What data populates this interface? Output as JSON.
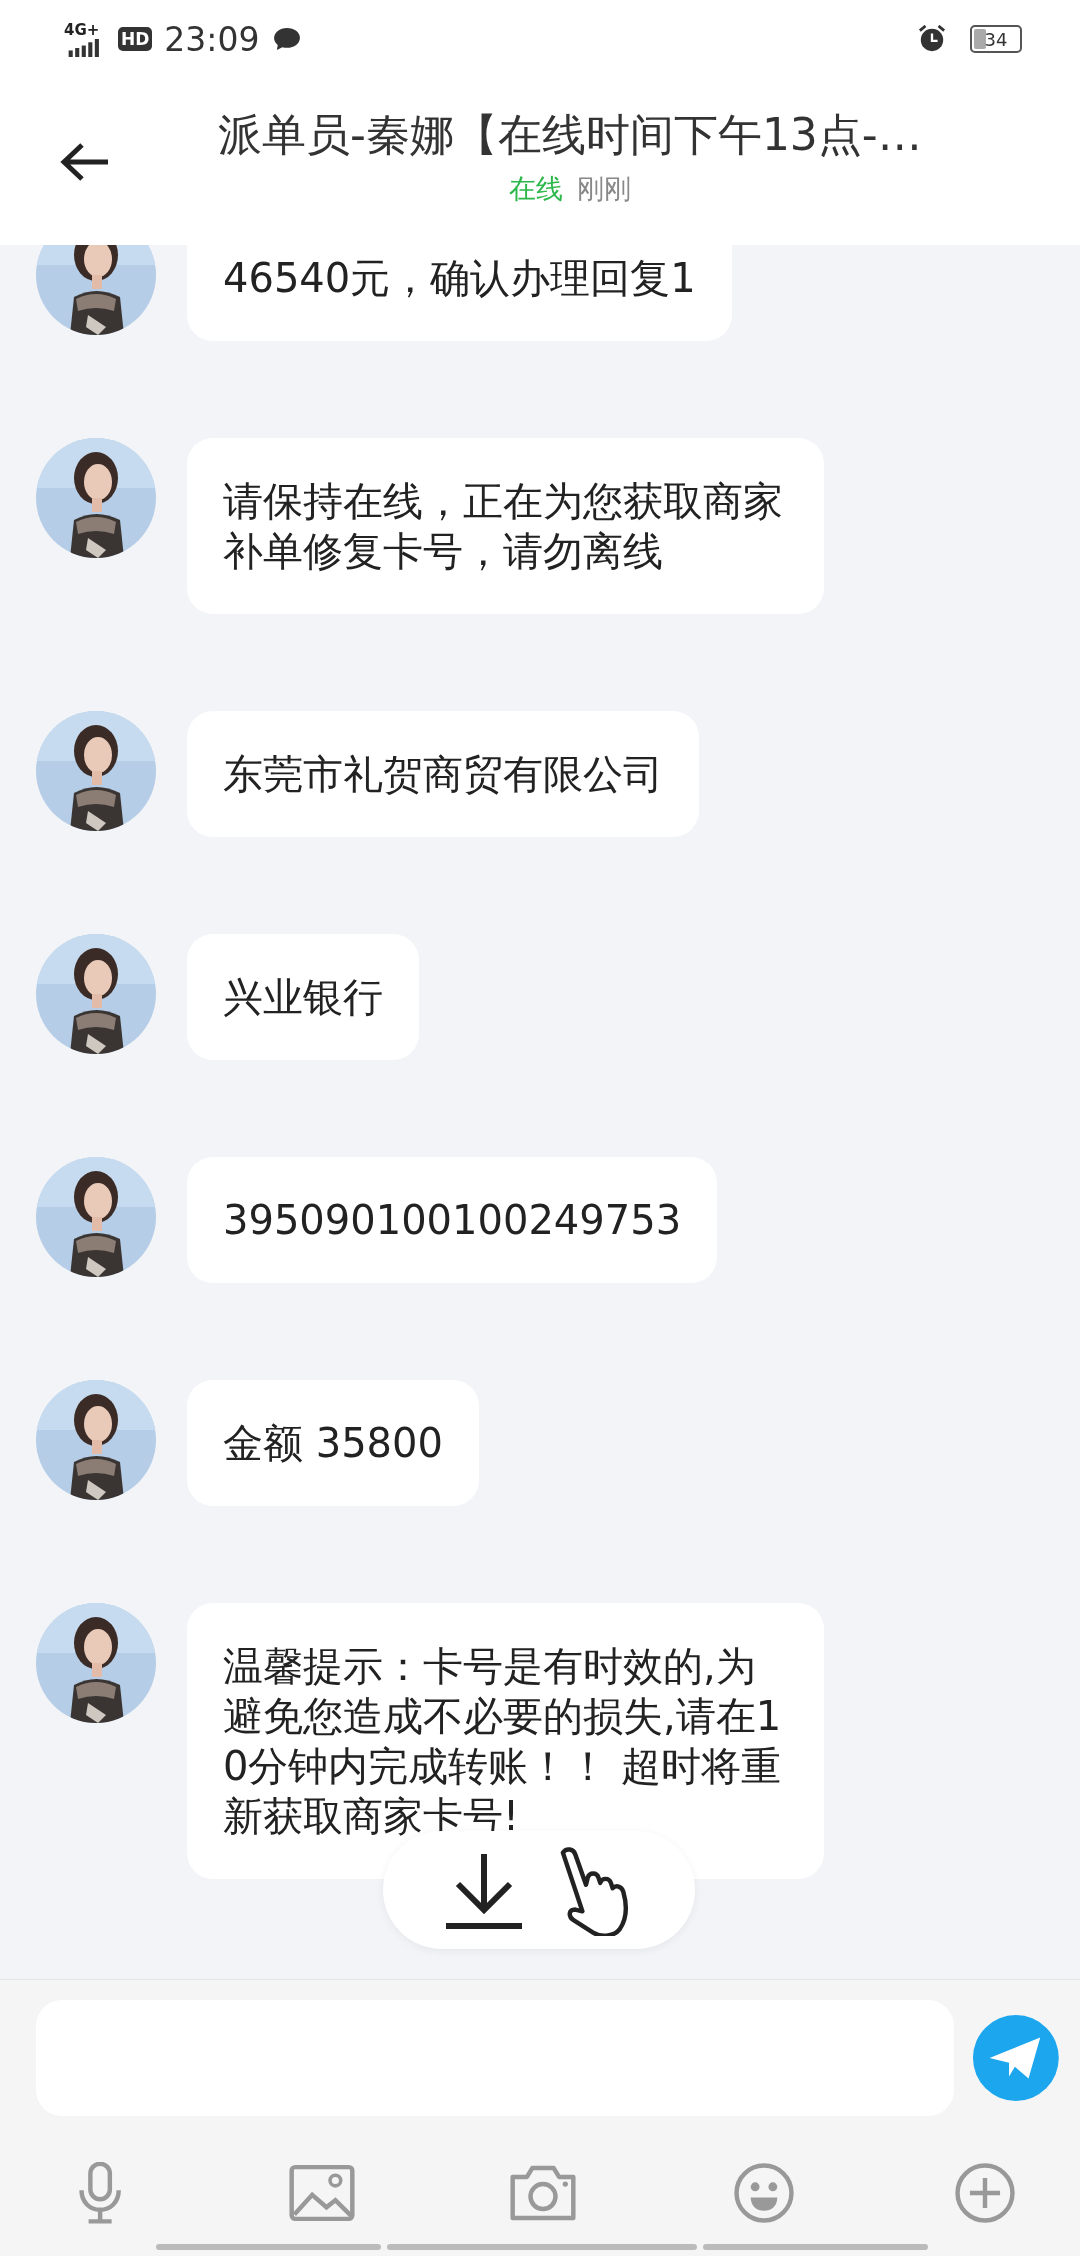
{
  "status_bar": {
    "network": "4G+",
    "hd": "HD",
    "time": "23:09",
    "battery": "34"
  },
  "header": {
    "title": "派单员-秦娜【在线时间下午13点-…",
    "presence": "在线",
    "last_seen": "刚刚"
  },
  "messages": [
    {
      "text": "46540元，确认办理回复1"
    },
    {
      "text": "请保持在线，正在为您获取商家补单修复卡号，请勿离线"
    },
    {
      "text": "东莞市礼贺商贸有限公司"
    },
    {
      "text": "兴业银行"
    },
    {
      "text": "395090100100249753"
    },
    {
      "text": "金额 35800"
    },
    {
      "text": "温馨提示：卡号是有时效的,为避免您造成不必要的损失,请在10分钟内完成转账！！ 超时将重新获取商家卡号!"
    }
  ]
}
